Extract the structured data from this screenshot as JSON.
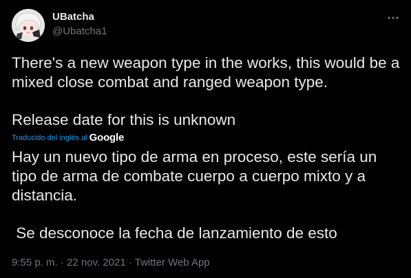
{
  "author": {
    "display_name": "UBatcha",
    "handle": "@Ubatcha1"
  },
  "tweet": {
    "text_line1": "There's a new weapon type in the works, this would be a mixed close combat and ranged weapon type.",
    "text_line2": "Release date for this is unknown"
  },
  "translation": {
    "label": "Traducido del inglés al",
    "provider": "Google",
    "text_line1": "Hay un nuevo tipo de arma en proceso, este sería un tipo de arma de combate cuerpo a cuerpo mixto y a distancia.",
    "text_line2": " Se desconoce la fecha de lanzamiento de esto"
  },
  "meta": {
    "time": "9:55 p. m.",
    "separator1": " · ",
    "date": "22 nov. 2021",
    "separator2": " · ",
    "source": "Twitter Web App"
  },
  "icons": {
    "more": "more-dots-icon",
    "avatar": "avatar-image"
  },
  "colors": {
    "background": "#000000",
    "text_primary": "#e7e9ea",
    "text_secondary": "#71767b",
    "accent": "#1d9bf0"
  }
}
